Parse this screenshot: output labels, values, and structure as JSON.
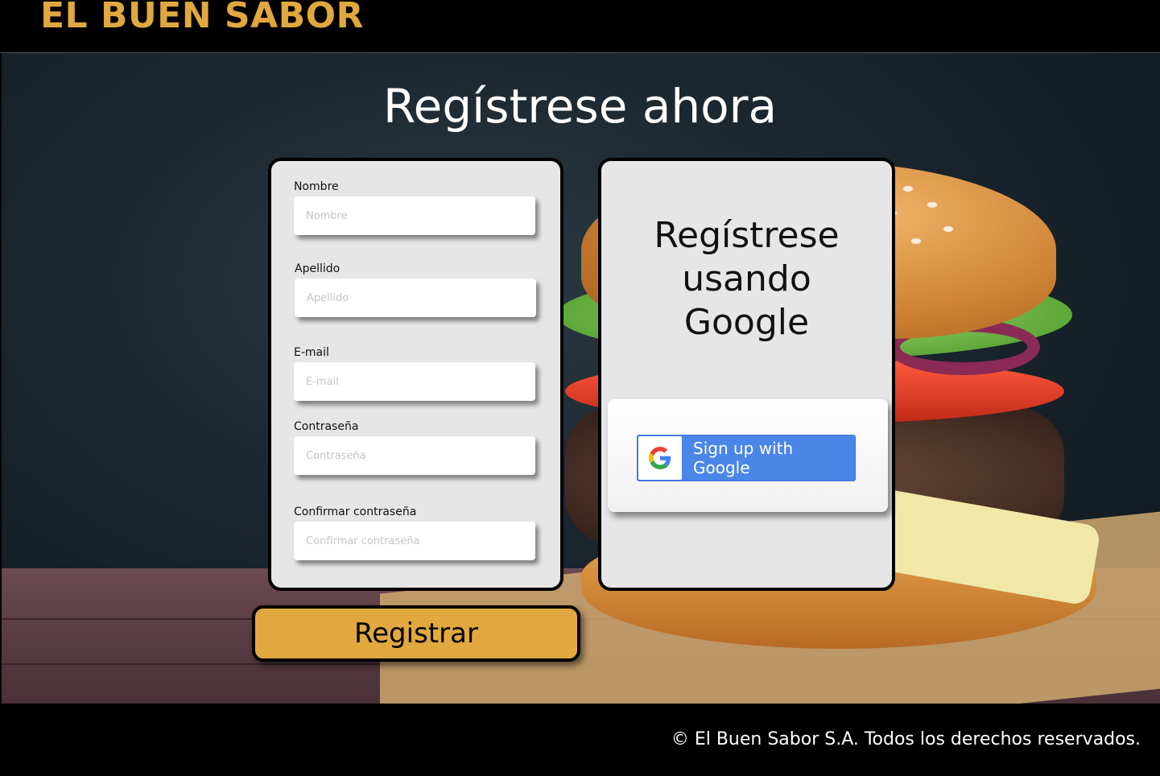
{
  "header": {
    "brand": "EL BUEN SABOR"
  },
  "main": {
    "title": "Regístrese ahora"
  },
  "form": {
    "fields": [
      {
        "label": "Nombre",
        "placeholder": "Nombre",
        "value": ""
      },
      {
        "label": "Apellido",
        "placeholder": "Apellido",
        "value": ""
      },
      {
        "label": "E-mail",
        "placeholder": "E-mail",
        "value": ""
      },
      {
        "label": "Contraseña",
        "placeholder": "Contraseña",
        "value": ""
      },
      {
        "label": "Confirmar contraseña",
        "placeholder": "Confirmar contraseña",
        "value": ""
      }
    ],
    "submit_label": "Registrar"
  },
  "google": {
    "title_line1": "Regístrese",
    "title_line2": "usando",
    "title_line3": "Google",
    "button_label": "Sign up with Google",
    "icon": "google-g-icon"
  },
  "footer": {
    "copyright": "© El Buen Sabor S.A. Todos los derechos reservados."
  },
  "colors": {
    "accent": "#e0a83e",
    "google_blue": "#4a86e8",
    "card_bg": "#e6e6e6"
  }
}
